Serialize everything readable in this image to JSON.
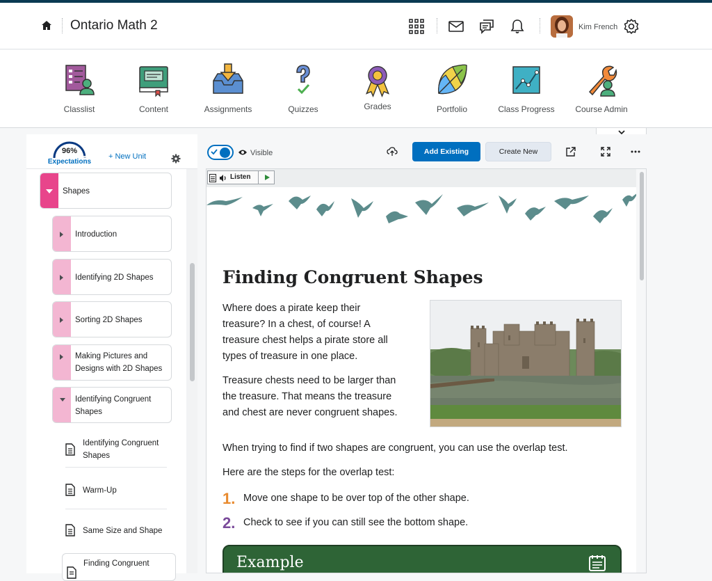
{
  "header": {
    "course_title": "Ontario Math 2",
    "user_name": "Kim French"
  },
  "nav": {
    "items": [
      {
        "label": "Classlist",
        "icon": "classlist-icon"
      },
      {
        "label": "Content",
        "icon": "content-book-icon"
      },
      {
        "label": "Assignments",
        "icon": "assignments-inbox-icon"
      },
      {
        "label": "Quizzes",
        "icon": "quizzes-question-icon"
      },
      {
        "label": "Grades",
        "icon": "grades-ribbon-icon"
      },
      {
        "label": "Portfolio",
        "icon": "portfolio-leaf-icon"
      },
      {
        "label": "Class Progress",
        "icon": "class-progress-chart-icon"
      },
      {
        "label": "Course Admin",
        "icon": "course-admin-wrench-icon"
      }
    ]
  },
  "panel": {
    "progress_pct": "96%",
    "progress_value": 0.96,
    "progress_label": "Expectations",
    "new_unit_label": "+ New Unit",
    "unit": {
      "label": "Shapes"
    },
    "lessons": [
      {
        "label": "Introduction"
      },
      {
        "label": "Identifying 2D Shapes"
      },
      {
        "label": "Sorting 2D Shapes"
      },
      {
        "label_line1": "Making Pictures and",
        "label_line2": "Designs with 2D Shapes"
      },
      {
        "label_line1": "Identifying Congruent",
        "label_line2": "Shapes"
      }
    ],
    "topics": [
      {
        "label_line1": "Identifying Congruent",
        "label_line2": "Shapes"
      },
      {
        "label": "Warm-Up"
      },
      {
        "label": "Same Size and Shape"
      },
      {
        "label": "Finding Congruent"
      }
    ]
  },
  "toolbar": {
    "visible_label": "Visible",
    "add_existing_label": "Add Existing",
    "create_new_label": "Create New"
  },
  "content": {
    "listen_label": "Listen",
    "title": "Finding Congruent Shapes",
    "para1_lines": [
      "Where does a pirate keep their",
      "treasure? In a chest, of course! A",
      "treasure chest helps a pirate store all",
      "types of treasure in one place."
    ],
    "para2_lines": [
      "Treasure chests need to be larger than",
      "the treasure. That means the treasure",
      "and chest are never congruent shapes."
    ],
    "para3": "When trying to find if two shapes are congruent, you can use the overlap test.",
    "para4": "Here are the steps for the overlap test:",
    "steps": [
      {
        "num": "1.",
        "text": "Move one shape to be over top of the other shape.",
        "color": "#e88a2e"
      },
      {
        "num": "2.",
        "text": "Check to see if you can still see the bottom shape.",
        "color": "#7a4a9a"
      }
    ],
    "example_title": "Example"
  },
  "colors": {
    "primary": "#006fbf",
    "unit_strip": "#e8458b",
    "lesson_strip": "#f3b6d2",
    "example_bg": "#2e6436"
  }
}
